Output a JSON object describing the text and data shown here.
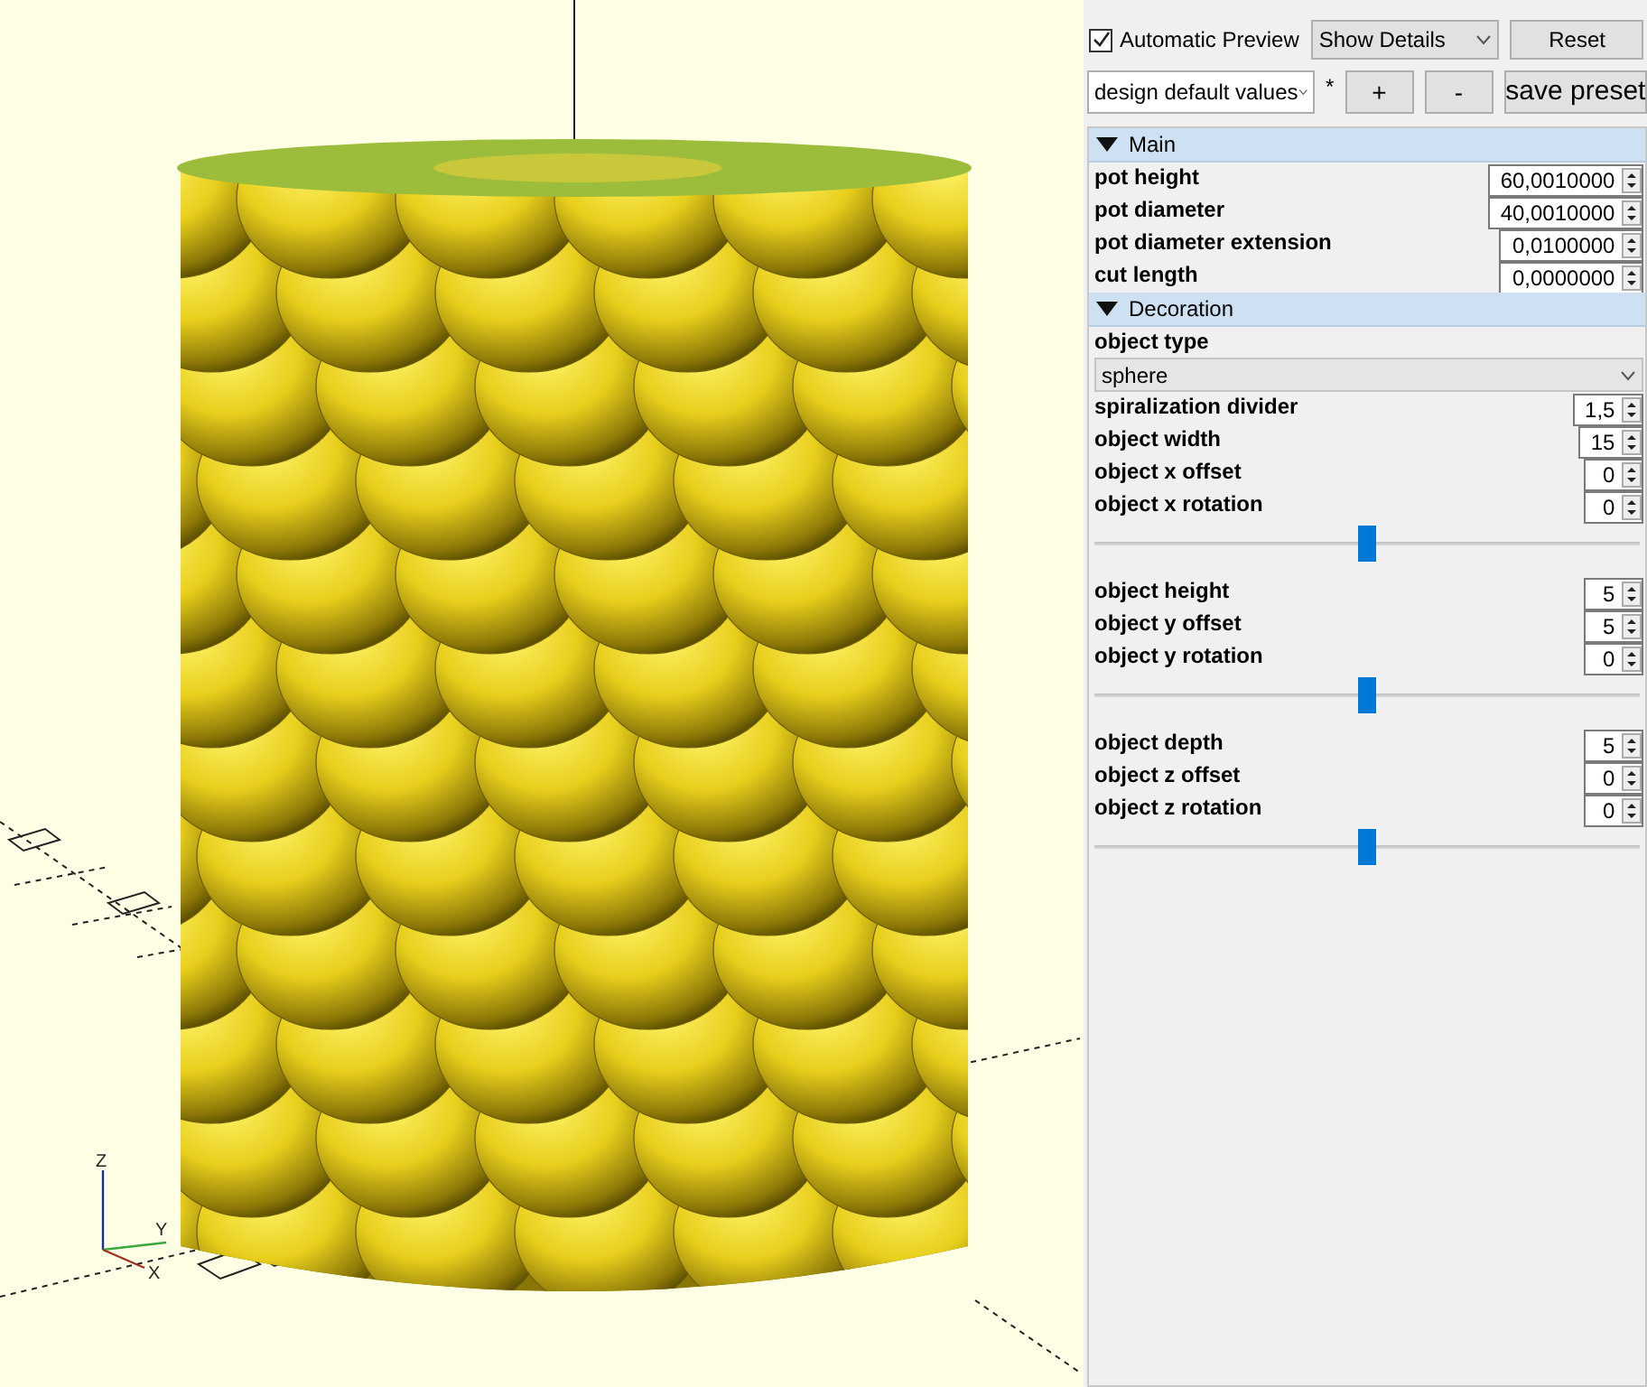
{
  "viewport": {
    "axis_labels": [
      "Z",
      "Y",
      "X"
    ]
  },
  "toolbar": {
    "automatic_preview": {
      "label": "Automatic Preview",
      "checked": true
    },
    "details_select": "Show Details",
    "reset_button": "Reset"
  },
  "presets": {
    "select": "design default values",
    "modified_mark": "*",
    "buttons": [
      "+",
      "-",
      "save preset"
    ]
  },
  "sections": [
    {
      "title": "Main",
      "expanded": true,
      "params": [
        {
          "kind": "spin",
          "label": "pot height",
          "value": "60,0010000"
        },
        {
          "kind": "spin",
          "label": "pot diameter",
          "value": "40,0010000"
        },
        {
          "kind": "spin",
          "label": "pot diameter extension",
          "value": "0,0100000"
        },
        {
          "kind": "spin",
          "label": "cut length",
          "value": "0,0000000"
        }
      ]
    },
    {
      "title": "Decoration",
      "expanded": true,
      "params": [
        {
          "kind": "select",
          "label": "object type",
          "value": "sphere"
        },
        {
          "kind": "spin",
          "label": "spiralization divider",
          "value": "1,5"
        },
        {
          "kind": "spin",
          "label": "object width",
          "value": "15"
        },
        {
          "kind": "spin",
          "label": "object x offset",
          "value": "0"
        },
        {
          "kind": "spin",
          "label": "object x rotation",
          "value": "0"
        },
        {
          "kind": "slider",
          "level": 0.5
        },
        {
          "kind": "spin",
          "label": "object height",
          "value": "5"
        },
        {
          "kind": "spin",
          "label": "object y offset",
          "value": "5"
        },
        {
          "kind": "spin",
          "label": "object y rotation",
          "value": "0"
        },
        {
          "kind": "slider",
          "level": 0.5
        },
        {
          "kind": "spin",
          "label": "object depth",
          "value": "5"
        },
        {
          "kind": "spin",
          "label": "object z offset",
          "value": "0"
        },
        {
          "kind": "spin",
          "label": "object z rotation",
          "value": "0"
        },
        {
          "kind": "slider",
          "level": 0.5
        }
      ]
    }
  ]
}
